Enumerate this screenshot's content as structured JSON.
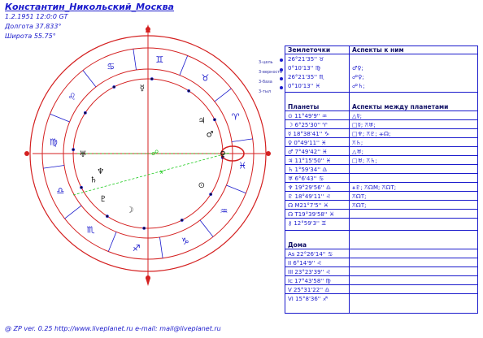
{
  "header": {
    "title": "Константин_Никольский_Москва",
    "datetime": "1.2.1951 12:0:0 GT",
    "longitude": "Долгота 37.833°",
    "latitude": "Широта 55.75°"
  },
  "footer": {
    "text": "@ ZP  ver. 0.25 http://www.liveplanet.ru  e-mail: mail@liveplanet.ru"
  },
  "colors": {
    "ring": "#d42020",
    "text": "#1a1acc",
    "aspect_green": "#22cc22",
    "highlight": "#d42020"
  },
  "wheel": {
    "zodiac_signs": [
      "♓",
      "♒",
      "♑",
      "♐",
      "♏",
      "♎",
      "♍",
      "♌",
      "♋",
      "♊",
      "♉",
      "♈"
    ],
    "inner_planets": [
      "☿",
      "♅",
      "♇",
      "♄",
      "♆",
      "☽",
      "⊙",
      "♀",
      "♂",
      "♃"
    ],
    "center_glyphs": [
      "☍",
      "⚹"
    ],
    "side_labels": [
      "3-цель",
      "3-верность",
      "3-база",
      "3-тыл"
    ]
  },
  "table": {
    "section1": {
      "col1_header": "Землеточки",
      "col2_header": "Аспекты к ним",
      "rows": [
        {
          "point": "26°21'35'' ♉",
          "aspects": ""
        },
        {
          "point": "0°10'13'' ♍",
          "aspects": "♂♀;"
        },
        {
          "point": "26°21'35'' ♏",
          "aspects": "☍♀;"
        },
        {
          "point": "0°10'13'' ♓",
          "aspects": "☍♄;"
        }
      ]
    },
    "section2": {
      "col1_header": "Планеты",
      "col2_header": "Аспекты между планетами",
      "rows": [
        {
          "planet": "⊙ 11°49'9'' ♒",
          "aspects": "△☿;"
        },
        {
          "planet": "☽ 6°25'30'' ♈",
          "aspects": "□☿; ⚻♅;"
        },
        {
          "planet": "☿ 18°38'41'' ♑",
          "aspects": "□♆; ⚻♇; ⚹☊;"
        },
        {
          "planet": "♀ 0°49'11'' ♓",
          "aspects": "⚻♄;"
        },
        {
          "planet": "♂ 7°49'42'' ♓",
          "aspects": "△♅;"
        },
        {
          "planet": "♃ 11°15'50'' ♓",
          "aspects": "□♅;  ⚻♄;"
        },
        {
          "planet": "♄ 1°59'34'' ♎",
          "aspects": ""
        },
        {
          "planet": "♅ 6°6'43'' ♋",
          "aspects": ""
        },
        {
          "planet": "♆ 19°29'56'' ♎",
          "aspects": "⚹♇;  ⚻☊M;  ⚻☊T;"
        },
        {
          "planet": "♇ 18°49'11'' ♌",
          "aspects": "⚻☊T;"
        },
        {
          "planet": "☊ M21°7'5'' ♓",
          "aspects": "⚻☊T;"
        },
        {
          "planet": "☊ T19°39'58'' ♓",
          "aspects": ""
        },
        {
          "planet": "⚷ 12°59'3'' ♊",
          "aspects": ""
        }
      ]
    },
    "section3": {
      "col1_header": "Дома",
      "rows": [
        {
          "house": "As 22°26'14'' ♋"
        },
        {
          "house": "II 6°14'9'' ♌"
        },
        {
          "house": "III 23°23'39'' ♌"
        },
        {
          "house": "Ic 17°43'58'' ♍"
        },
        {
          "house": "V 25°31'22'' ♎"
        },
        {
          "house": "VI 15°8'36'' ♐"
        }
      ]
    }
  }
}
